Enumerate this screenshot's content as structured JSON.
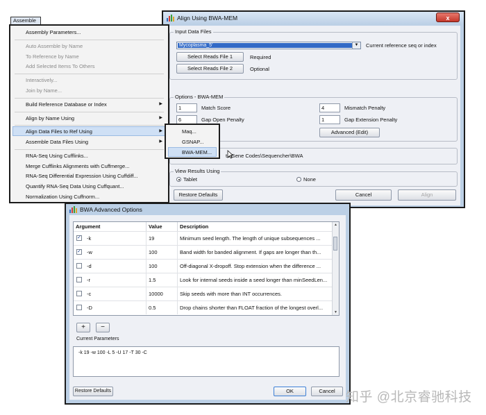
{
  "colors": {
    "title_bar": "#bcd0e6",
    "selection": "#3169c6",
    "highlight": "#cfe0f5",
    "close_button": "#c4372b",
    "watermark": "#b8b8b8"
  },
  "menu_bar": {
    "assemble_label": "Assemble"
  },
  "assemble_menu": {
    "items": [
      {
        "label": "Assembly Parameters..."
      },
      {
        "label": "Auto Assemble by Name"
      },
      {
        "label": "To Reference by Name"
      },
      {
        "label": "Add Selected Items To Others"
      },
      {
        "label": "Interactively..."
      },
      {
        "label": "Join by Name..."
      },
      {
        "label": "Build Reference Database or Index"
      },
      {
        "label": "Align by Name Using"
      },
      {
        "label": "Align Data Files to Ref Using"
      },
      {
        "label": "Assemble Data Files Using"
      },
      {
        "label": "RNA-Seq Using Cufflinks..."
      },
      {
        "label": "Merge Cufflinks Alignments with Cuffmerge..."
      },
      {
        "label": "RNA-Seq Differential Expression Using Cuffdiff..."
      },
      {
        "label": "Quantify RNA-Seq Data Using Cuffquant..."
      },
      {
        "label": "Normalization Using Cuffnorm..."
      }
    ],
    "submenu": [
      {
        "label": "Maq..."
      },
      {
        "label": "GSNAP..."
      },
      {
        "label": "BWA-MEM..."
      }
    ]
  },
  "align_window": {
    "title": "Align Using BWA-MEM",
    "close_glyph": "x",
    "input_group": {
      "legend": "Input Data Files",
      "reference_value": "Mycoplasma_5'",
      "reference_hint": "Current reference seq or index",
      "reads1_button": "Select Reads File 1",
      "reads1_status": "Required",
      "reads2_button": "Select Reads File 2",
      "reads2_status": "Optional"
    },
    "options_group": {
      "legend": "Options - BWA-MEM",
      "match_score_value": "1",
      "match_score_label": "Match Score",
      "mismatch_value": "4",
      "mismatch_label": "Mismatch Penalty",
      "gap_open_value": "6",
      "gap_open_label": "Gap Open Penalty",
      "gap_ext_value": "1",
      "gap_ext_label": "Gap Extension Penalty",
      "advanced_button": "Advanced (Edit)"
    },
    "path_text": "ts\\Gene Codes\\Sequencher\\BWA",
    "view_group": {
      "legend": "View Results Using",
      "tablet_label": "Tablet",
      "none_label": "None"
    },
    "restore_button": "Restore Defaults",
    "cancel_button": "Cancel",
    "align_button": "Align"
  },
  "bwa_window": {
    "title": "BWA Advanced Options",
    "columns": [
      "Argument",
      "Value",
      "Description"
    ],
    "rows": [
      {
        "checked": true,
        "arg": "-k",
        "value": "19",
        "desc": "Minimum seed length. The length of unique subsequences ..."
      },
      {
        "checked": true,
        "arg": "-w",
        "value": "100",
        "desc": "Band width for banded alignment. If gaps are longer than th..."
      },
      {
        "checked": false,
        "arg": "-d",
        "value": "100",
        "desc": "Off-diagonal X-dropoff. Stop extension when the difference ..."
      },
      {
        "checked": false,
        "arg": "-r",
        "value": "1.5",
        "desc": "Look for internal seeds inside a seed longer than minSeedLen..."
      },
      {
        "checked": false,
        "arg": "-c",
        "value": "10000",
        "desc": "Skip seeds with more than INT occurrences."
      },
      {
        "checked": false,
        "arg": "-D",
        "value": "0.5",
        "desc": "Drop chains shorter than FLOAT fraction of the longest overl..."
      }
    ],
    "add_label": "+",
    "remove_label": "−",
    "params_label": "Current Parameters",
    "params_value": "-k 19 -w 100 -L 5 -U 17 -T 30 -C",
    "restore_button": "Restore Defaults",
    "ok_button": "OK",
    "cancel_button": "Cancel"
  },
  "watermark": "知乎 @北京睿驰科技"
}
